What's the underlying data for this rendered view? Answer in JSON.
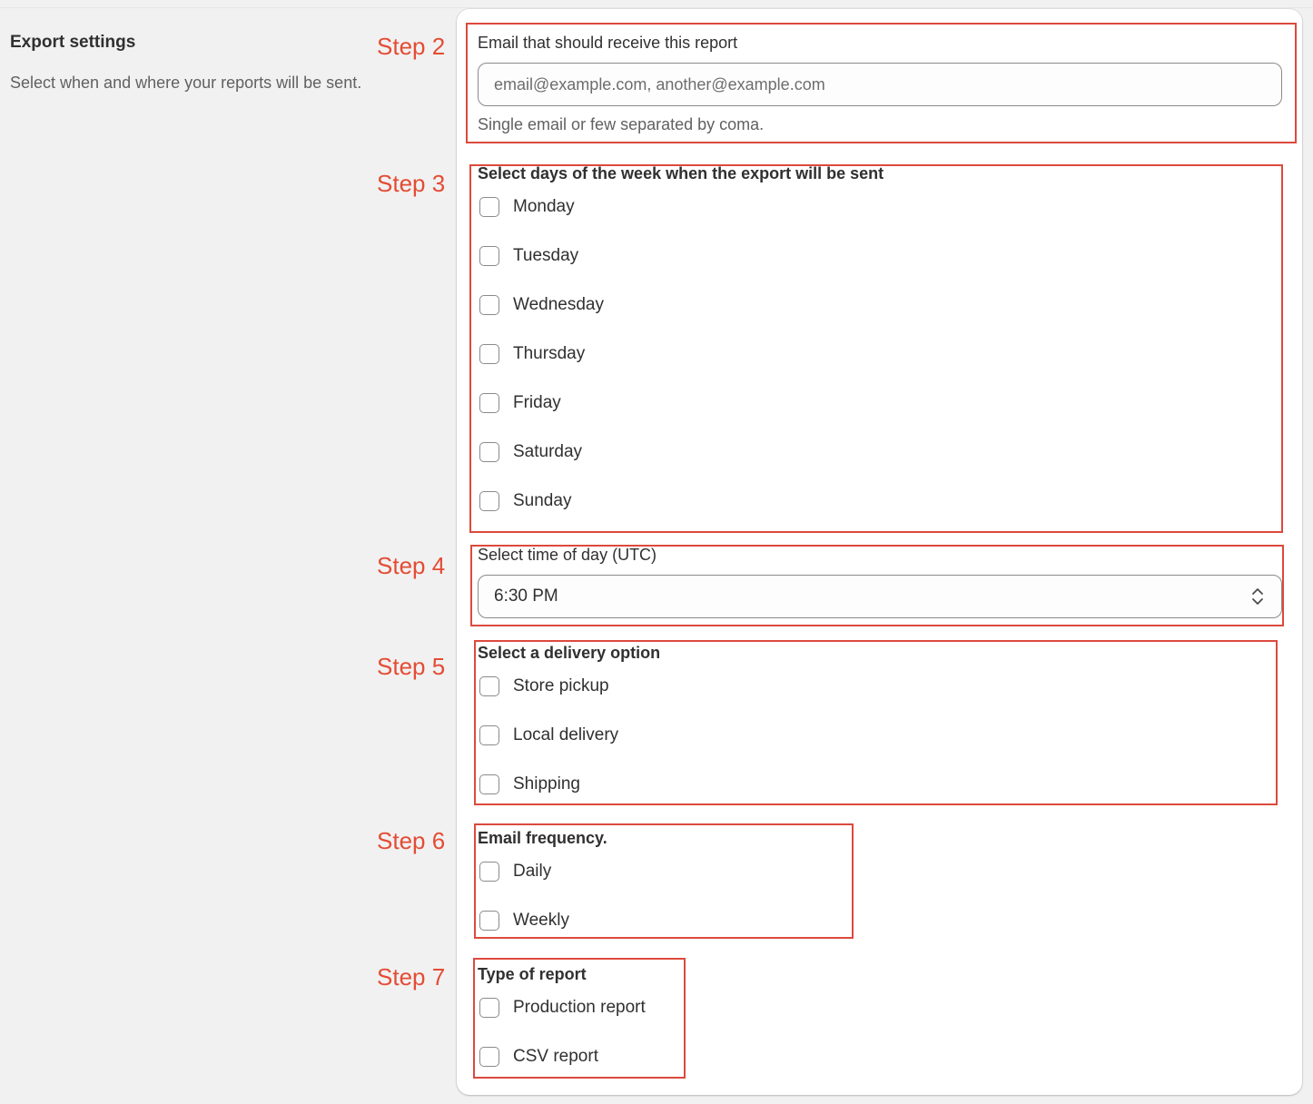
{
  "left": {
    "title": "Export settings",
    "description": "Select when and where your reports will be sent."
  },
  "steps": [
    "Step 2",
    "Step 3",
    "Step 4",
    "Step 5",
    "Step 6",
    "Step 7"
  ],
  "email": {
    "label": "Email that should receive this report",
    "placeholder": "email@example.com, another@example.com",
    "value": "",
    "help": "Single email or few separated by coma."
  },
  "days": {
    "label": "Select days of the week when the export will be sent",
    "options": [
      {
        "label": "Monday",
        "checked": false
      },
      {
        "label": "Tuesday",
        "checked": false
      },
      {
        "label": "Wednesday",
        "checked": false
      },
      {
        "label": "Thursday",
        "checked": false
      },
      {
        "label": "Friday",
        "checked": false
      },
      {
        "label": "Saturday",
        "checked": false
      },
      {
        "label": "Sunday",
        "checked": false
      }
    ]
  },
  "time": {
    "label": "Select time of day (UTC)",
    "value": "6:30 PM"
  },
  "delivery": {
    "label": "Select a delivery option",
    "options": [
      {
        "label": "Store pickup",
        "checked": false
      },
      {
        "label": "Local delivery",
        "checked": false
      },
      {
        "label": "Shipping",
        "checked": false
      }
    ]
  },
  "frequency": {
    "label": "Email frequency.",
    "options": [
      {
        "label": "Daily",
        "checked": false
      },
      {
        "label": "Weekly",
        "checked": false
      }
    ]
  },
  "report_type": {
    "label": "Type of report",
    "options": [
      {
        "label": "Production report",
        "checked": false
      },
      {
        "label": "CSV report",
        "checked": false
      }
    ]
  },
  "colors": {
    "annotation": "#e44c34",
    "annotation_box": "#dc4a3d",
    "page_bg": "#f1f1f1",
    "card_bg": "#ffffff"
  }
}
